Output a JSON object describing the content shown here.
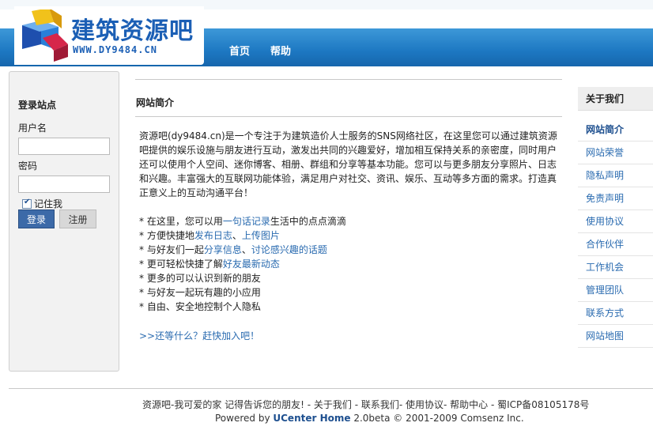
{
  "header": {
    "logo_title": "建筑资源吧",
    "logo_url": "WWW.DY9484.CN",
    "nav": [
      "首页",
      "帮助"
    ]
  },
  "login": {
    "title": "登录站点",
    "username_label": "用户名",
    "password_label": "密码",
    "remember_label": "记住我",
    "login_button": "登录",
    "register_button": "注册"
  },
  "main": {
    "title": "网站简介",
    "intro": "资源吧(dy9484.cn)是一个专注于为建筑造价人士服务的SNS网络社区，在这里您可以通过建筑资源吧提供的娱乐设施与朋友进行互动，激发出共同的兴趣爱好，增加相互保持关系的亲密度，同时用户还可以使用个人空间、迷你博客、相册、群组和分享等基本功能。您可以与更多朋友分享照片、日志和兴趣。丰富强大的互联网功能体验，满足用户对社交、资讯、娱乐、互动等多方面的需求。打造真正意义上的互动沟通平台！",
    "features": [
      {
        "pre": "在这里，您可以用",
        "link": "一句话记录",
        "post": "生活中的点点滴滴"
      },
      {
        "pre": "方便快捷地",
        "link": "发布日志",
        "mid": "、",
        "link2": "上传图片",
        "post": ""
      },
      {
        "pre": "与好友们一起",
        "link": "分享信息",
        "mid": "、",
        "link2": "讨论感兴趣的话题",
        "post": ""
      },
      {
        "pre": "更可轻松快捷了解",
        "link": "好友最新动态",
        "post": ""
      },
      {
        "pre": "更多的可以认识到新的朋友",
        "link": "",
        "post": ""
      },
      {
        "pre": "与好友一起玩有趣的小应用",
        "link": "",
        "post": ""
      },
      {
        "pre": "自由、安全地控制个人隐私",
        "link": "",
        "post": ""
      }
    ],
    "join_text": ">>还等什么？赶快加入吧！"
  },
  "sidebar": {
    "title": "关于我们",
    "items": [
      "网站简介",
      "网站荣誉",
      "隐私声明",
      "免责声明",
      "使用协议",
      "合作伙伴",
      "工作机会",
      "管理团队",
      "联系方式",
      "网站地图"
    ]
  },
  "footer": {
    "line1": "资源吧-我可爱的家  记得告诉您的朋友!  - 关于我们 - 联系我们- 使用协议- 帮助中心 - 蜀ICP备08105178号",
    "powered_pre": "Powered by ",
    "powered_brand": "UCenter Home",
    "powered_post": " 2.0beta © 2001-2009 Comsenz Inc."
  },
  "colors": {
    "header_blue": "#1d78c2",
    "link": "#2a6bb0",
    "button_blue": "#3c6aa8"
  }
}
